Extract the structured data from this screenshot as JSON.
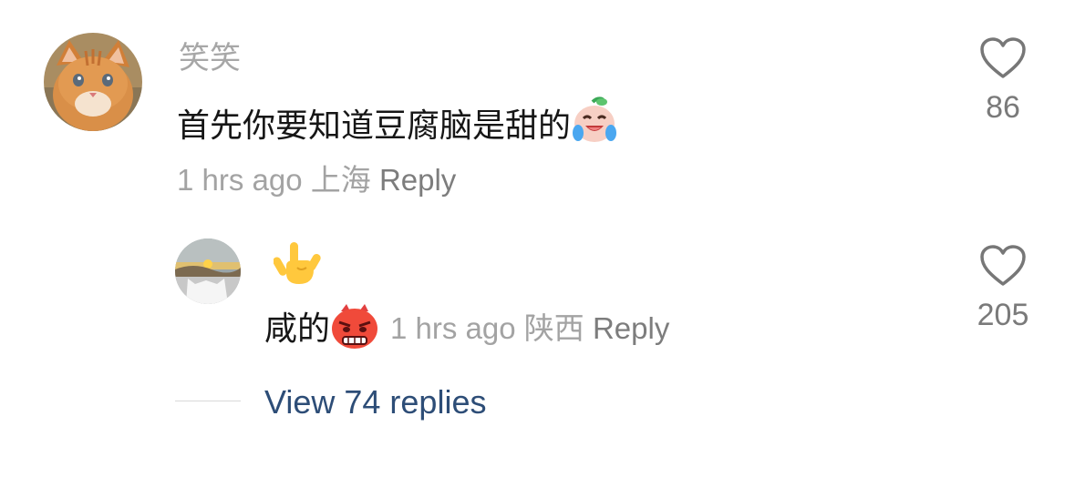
{
  "comment": {
    "username": "笑笑",
    "text": "首先你要知道豆腐脑是甜的",
    "text_emoji": "laughing-crying-face-emoji",
    "time": "1 hrs ago",
    "location": "上海",
    "reply_label": "Reply",
    "likes": "86"
  },
  "reply": {
    "emoji_line": "🤟",
    "text": "咸的",
    "text_emoji": "angry-face-emoji",
    "time": "1 hrs ago",
    "location": "陕西",
    "reply_label": "Reply",
    "likes": "205"
  },
  "view_replies": "View 74 replies",
  "colors": {
    "username": "#a7a7a7",
    "body_text": "#161616",
    "meta": "#a3a3a3",
    "link": "#2d4d77",
    "heart_outline": "#777777"
  }
}
